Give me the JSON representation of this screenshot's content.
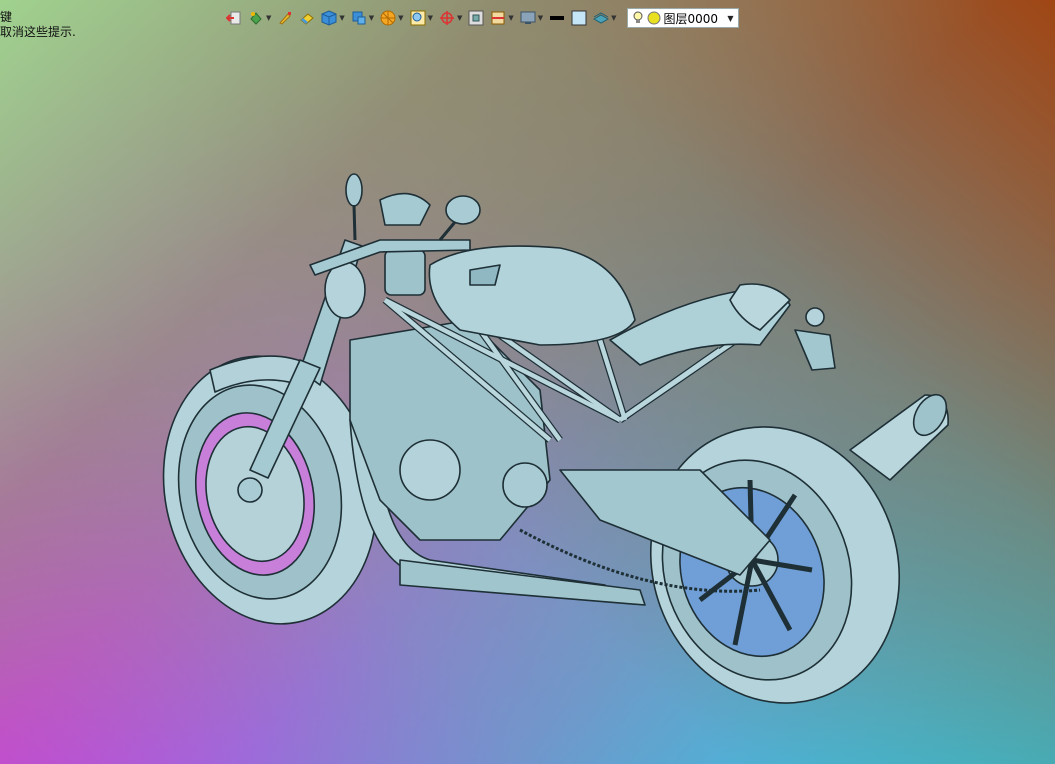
{
  "hint": {
    "line1": "键",
    "line2": "取消这些提示."
  },
  "toolbar": {
    "items": [
      {
        "icon": "exit-icon",
        "dropdown": false
      },
      {
        "icon": "paint-bucket-icon",
        "dropdown": true
      },
      {
        "icon": "brush-icon",
        "dropdown": false
      },
      {
        "icon": "eraser-icon",
        "dropdown": false
      },
      {
        "icon": "cube-icon",
        "dropdown": true
      },
      {
        "icon": "render-icon",
        "dropdown": true
      },
      {
        "icon": "sphere-icon",
        "dropdown": true
      },
      {
        "icon": "zoom-window-icon",
        "dropdown": true
      },
      {
        "icon": "crosshair-icon",
        "dropdown": true
      },
      {
        "icon": "fit-icon",
        "dropdown": false
      },
      {
        "icon": "section-icon",
        "dropdown": true
      },
      {
        "icon": "display-icon",
        "dropdown": true
      },
      {
        "icon": "line-weight-icon",
        "dropdown": false
      },
      {
        "icon": "color-swatch-icon",
        "dropdown": false
      },
      {
        "icon": "layers-icon",
        "dropdown": true
      }
    ],
    "layer": {
      "value": "图层0000"
    }
  },
  "colors": {
    "model_fill": "#a9ccd4",
    "model_stroke": "#1e2f36"
  }
}
